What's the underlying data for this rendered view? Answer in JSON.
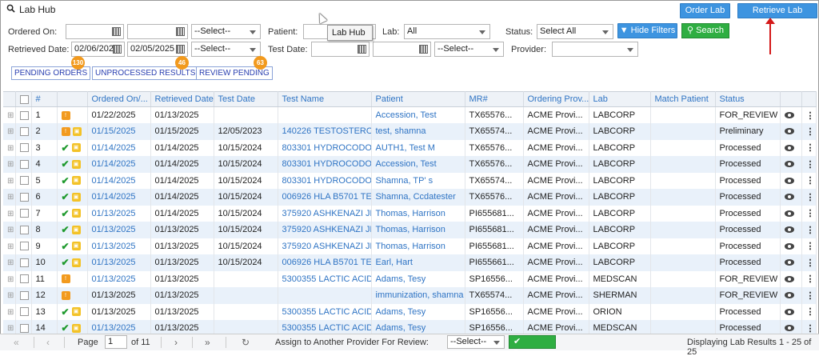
{
  "header": {
    "title": "Lab Hub",
    "order_lab": "Order Lab",
    "retrieve": "Retrieve Lab Results"
  },
  "tooltip": "Lab Hub",
  "filters": {
    "ordered_on_label": "Ordered On:",
    "retrieved_date_label": "Retrieved Date:",
    "retrieved_from": "02/06/202",
    "retrieved_to": "02/05/2025",
    "select_placeholder": "--Select--",
    "patient_label": "Patient:",
    "test_date_label": "Test Date:",
    "lab_label": "Lab:",
    "lab_value": "All",
    "provider_label": "Provider:",
    "status_label": "Status:",
    "status_value": "Select All",
    "hide_filters": "Hide Filters",
    "search": "Search"
  },
  "quick": [
    {
      "label": "PENDING ORDERS",
      "count": "130"
    },
    {
      "label": "UNPROCESSED RESULTS",
      "count": "46"
    },
    {
      "label": "REVIEW PENDING",
      "count": "63"
    }
  ],
  "columns": [
    "#",
    "Ordered On/...",
    "Retrieved Date",
    "Test Date",
    "Test Name",
    "Patient",
    "MR#",
    "Ordering Prov...",
    "Lab",
    "Match Patient",
    "Status"
  ],
  "rows": [
    {
      "n": "1",
      "ordered": "01/22/2025",
      "retrieved": "01/13/2025",
      "test_date": "",
      "test": "",
      "patient": "Accession, Test",
      "mr": "TX65576...",
      "prov": "ACME Provi...",
      "lab": "LABCORP",
      "status": "FOR_REVIEW",
      "check": false,
      "red": true,
      "yellow": false,
      "ord_link": false
    },
    {
      "n": "2",
      "ordered": "01/15/2025",
      "retrieved": "01/15/2025",
      "test_date": "12/05/2023",
      "test": "140226 TESTOSTERON",
      "patient": "test, shamna",
      "mr": "TX65574...",
      "prov": "ACME Provi...",
      "lab": "LABCORP",
      "status": "Preliminary",
      "check": false,
      "red": true,
      "yellow": true,
      "ord_link": true
    },
    {
      "n": "3",
      "ordered": "01/14/2025",
      "retrieved": "01/14/2025",
      "test_date": "10/15/2024",
      "test": "803301 HYDROCODON",
      "patient": "AUTH1, Test M",
      "mr": "TX65576...",
      "prov": "ACME Provi...",
      "lab": "LABCORP",
      "status": "Processed",
      "check": true,
      "red": false,
      "yellow": true,
      "ord_link": true
    },
    {
      "n": "4",
      "ordered": "01/14/2025",
      "retrieved": "01/14/2025",
      "test_date": "10/15/2024",
      "test": "803301 HYDROCODON",
      "patient": "Accession, Test",
      "mr": "TX65576...",
      "prov": "ACME Provi...",
      "lab": "LABCORP",
      "status": "Processed",
      "check": true,
      "red": false,
      "yellow": true,
      "ord_link": true
    },
    {
      "n": "5",
      "ordered": "01/14/2025",
      "retrieved": "01/14/2025",
      "test_date": "10/15/2024",
      "test": "803301 HYDROCODON",
      "patient": "Shamna, TP' s",
      "mr": "TX65574...",
      "prov": "ACME Provi...",
      "lab": "LABCORP",
      "status": "Processed",
      "check": true,
      "red": false,
      "yellow": true,
      "ord_link": true
    },
    {
      "n": "6",
      "ordered": "01/14/2025",
      "retrieved": "01/14/2025",
      "test_date": "10/15/2024",
      "test": "006926 HLA B5701 TES",
      "patient": "Shamna, Ccdatester",
      "mr": "TX65576...",
      "prov": "ACME Provi...",
      "lab": "LABCORP",
      "status": "Processed",
      "check": true,
      "red": false,
      "yellow": true,
      "ord_link": true
    },
    {
      "n": "7",
      "ordered": "01/13/2025",
      "retrieved": "01/14/2025",
      "test_date": "10/15/2024",
      "test": "375920 ASHKENAZI JEW",
      "patient": "Thomas, Harrison",
      "mr": "PI655681...",
      "prov": "ACME Provi...",
      "lab": "LABCORP",
      "status": "Processed",
      "check": true,
      "red": false,
      "yellow": true,
      "ord_link": true
    },
    {
      "n": "8",
      "ordered": "01/13/2025",
      "retrieved": "01/13/2025",
      "test_date": "10/15/2024",
      "test": "375920 ASHKENAZI JEW",
      "patient": "Thomas, Harrison",
      "mr": "PI655681...",
      "prov": "ACME Provi...",
      "lab": "LABCORP",
      "status": "Processed",
      "check": true,
      "red": false,
      "yellow": true,
      "ord_link": true
    },
    {
      "n": "9",
      "ordered": "01/13/2025",
      "retrieved": "01/13/2025",
      "test_date": "10/15/2024",
      "test": "375920 ASHKENAZI JEW",
      "patient": "Thomas, Harrison",
      "mr": "PI655681...",
      "prov": "ACME Provi...",
      "lab": "LABCORP",
      "status": "Processed",
      "check": true,
      "red": false,
      "yellow": true,
      "ord_link": true
    },
    {
      "n": "10",
      "ordered": "01/13/2025",
      "retrieved": "01/13/2025",
      "test_date": "10/15/2024",
      "test": "006926 HLA B5701 TES",
      "patient": "Earl, Hart",
      "mr": "PI655661...",
      "prov": "ACME Provi...",
      "lab": "LABCORP",
      "status": "Processed",
      "check": true,
      "red": false,
      "yellow": true,
      "ord_link": true
    },
    {
      "n": "11",
      "ordered": "01/13/2025",
      "retrieved": "01/13/2025",
      "test_date": "",
      "test": "5300355 LACTIC ACID I",
      "patient": "Adams, Tesy",
      "mr": "SP16556...",
      "prov": "ACME Provi...",
      "lab": "MEDSCAN",
      "status": "FOR_REVIEW",
      "check": false,
      "red": true,
      "yellow": false,
      "ord_link": true
    },
    {
      "n": "12",
      "ordered": "01/13/2025",
      "retrieved": "01/13/2025",
      "test_date": "",
      "test": "",
      "patient": "immunization, shamna",
      "mr": "TX65574...",
      "prov": "ACME Provi...",
      "lab": "SHERMAN",
      "status": "FOR_REVIEW",
      "check": false,
      "red": true,
      "yellow": false,
      "ord_link": false
    },
    {
      "n": "13",
      "ordered": "01/13/2025",
      "retrieved": "01/13/2025",
      "test_date": "",
      "test": "5300355 LACTIC ACID I",
      "patient": "Adams, Tesy",
      "mr": "SP16556...",
      "prov": "ACME Provi...",
      "lab": "ORION",
      "status": "Processed",
      "check": true,
      "red": false,
      "yellow": true,
      "ord_link": false
    },
    {
      "n": "14",
      "ordered": "01/13/2025",
      "retrieved": "01/13/2025",
      "test_date": "",
      "test": "5300355 LACTIC ACID I",
      "patient": "Adams, Tesy",
      "mr": "SP16556...",
      "prov": "ACME Provi...",
      "lab": "MEDSCAN",
      "status": "Processed",
      "check": true,
      "red": false,
      "yellow": true,
      "ord_link": true
    }
  ],
  "footer": {
    "page_label": "Page",
    "page_value": "1",
    "of_pages": "of 11",
    "assign_label": "Assign to Another Provider For Review:",
    "assign_select": "--Select--",
    "process": "Process",
    "displaying": "Displaying Lab Results 1 - 25 of 25"
  }
}
